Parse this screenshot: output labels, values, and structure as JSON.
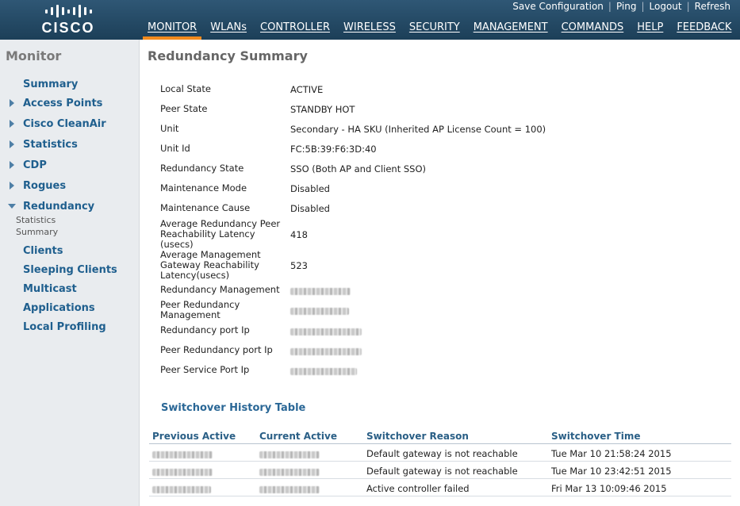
{
  "brand": {
    "logo_text": "CISCO"
  },
  "top_links": [
    "Save Configuration",
    "Ping",
    "Logout",
    "Refresh"
  ],
  "nav": [
    "MONITOR",
    "WLANs",
    "CONTROLLER",
    "WIRELESS",
    "SECURITY",
    "MANAGEMENT",
    "COMMANDS",
    "HELP",
    "FEEDBACK"
  ],
  "nav_active": "MONITOR",
  "colors": {
    "header": "#1f4560",
    "accent": "#f28a1d",
    "link": "#1f5f8e",
    "sidebar_bg": "#e9ecef"
  },
  "sidebar": {
    "title": "Monitor",
    "items": [
      {
        "label": "Summary",
        "arrow": "none"
      },
      {
        "label": "Access Points",
        "arrow": "right"
      },
      {
        "label": "Cisco CleanAir",
        "arrow": "right"
      },
      {
        "label": "Statistics",
        "arrow": "right"
      },
      {
        "label": "CDP",
        "arrow": "right"
      },
      {
        "label": "Rogues",
        "arrow": "right"
      },
      {
        "label": "Redundancy",
        "arrow": "down"
      },
      {
        "label": "Clients",
        "arrow": "none"
      },
      {
        "label": "Sleeping Clients",
        "arrow": "none"
      },
      {
        "label": "Multicast",
        "arrow": "none"
      },
      {
        "label": "Applications",
        "arrow": "none"
      },
      {
        "label": "Local Profiling",
        "arrow": "none"
      }
    ],
    "redundancy_sub": [
      "Statistics",
      "Summary"
    ]
  },
  "page_title": "Redundancy Summary",
  "summary": [
    {
      "label": "Local State",
      "value": "ACTIVE"
    },
    {
      "label": "Peer State",
      "value": "STANDBY HOT"
    },
    {
      "label": "Unit",
      "value": "Secondary - HA SKU (Inherited AP License Count = 100)"
    },
    {
      "label": "Unit Id",
      "value": "FC:5B:39:F6:3D:40"
    },
    {
      "label": "Redundancy State",
      "value": "SSO (Both AP and Client SSO)"
    },
    {
      "label": "Maintenance Mode",
      "value": "Disabled"
    },
    {
      "label": "Maintenance Cause",
      "value": "Disabled"
    },
    {
      "label": "Average Redundancy Peer Reachability Latency (usecs)",
      "value": "418"
    },
    {
      "label": "Average Management Gateway Reachability Latency(usecs)",
      "value": "523"
    },
    {
      "label": "Redundancy Management",
      "value": ""
    },
    {
      "label": "Peer Redundancy Management",
      "value": ""
    },
    {
      "label": "Redundancy port Ip",
      "value": ""
    },
    {
      "label": "Peer Redundancy port Ip",
      "value": ""
    },
    {
      "label": "Peer Service Port Ip",
      "value": ""
    }
  ],
  "history": {
    "title": "Switchover History Table",
    "columns": [
      "Previous Active",
      "Current Active",
      "Switchover Reason",
      "Switchover Time"
    ],
    "rows": [
      {
        "reason": "Default gateway is not reachable",
        "time": "Tue Mar 10 21:58:24 2015"
      },
      {
        "reason": "Default gateway is not reachable",
        "time": "Tue Mar 10 23:42:51 2015"
      },
      {
        "reason": "Active controller failed",
        "time": "Fri Mar 13 10:09:46 2015"
      }
    ]
  }
}
